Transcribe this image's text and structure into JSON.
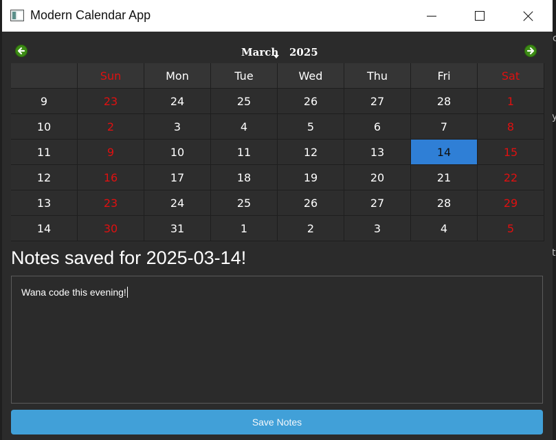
{
  "window": {
    "title": "Modern Calendar App"
  },
  "calendar": {
    "month": "March",
    "year": "2025",
    "weekdays": [
      "Sun",
      "Mon",
      "Tue",
      "Wed",
      "Thu",
      "Fri",
      "Sat"
    ],
    "weeks": [
      {
        "week": "9",
        "days": [
          "23",
          "24",
          "25",
          "26",
          "27",
          "28",
          "1"
        ]
      },
      {
        "week": "10",
        "days": [
          "2",
          "3",
          "4",
          "5",
          "6",
          "7",
          "8"
        ]
      },
      {
        "week": "11",
        "days": [
          "9",
          "10",
          "11",
          "12",
          "13",
          "14",
          "15"
        ]
      },
      {
        "week": "12",
        "days": [
          "16",
          "17",
          "18",
          "19",
          "20",
          "21",
          "22"
        ]
      },
      {
        "week": "13",
        "days": [
          "23",
          "24",
          "25",
          "26",
          "27",
          "28",
          "29"
        ]
      },
      {
        "week": "14",
        "days": [
          "30",
          "31",
          "1",
          "2",
          "3",
          "4",
          "5"
        ]
      }
    ],
    "selected": {
      "week_index": 2,
      "day_index": 5
    },
    "colors": {
      "weekend": "#e01010",
      "selected": "#2f7fd6",
      "nav_arrow": "#3d8b16"
    }
  },
  "notes": {
    "heading": "Notes saved for 2025-03-14!",
    "content": "Wana code this evening!"
  },
  "actions": {
    "save_label": "Save Notes",
    "save_color": "#41a0d8"
  }
}
